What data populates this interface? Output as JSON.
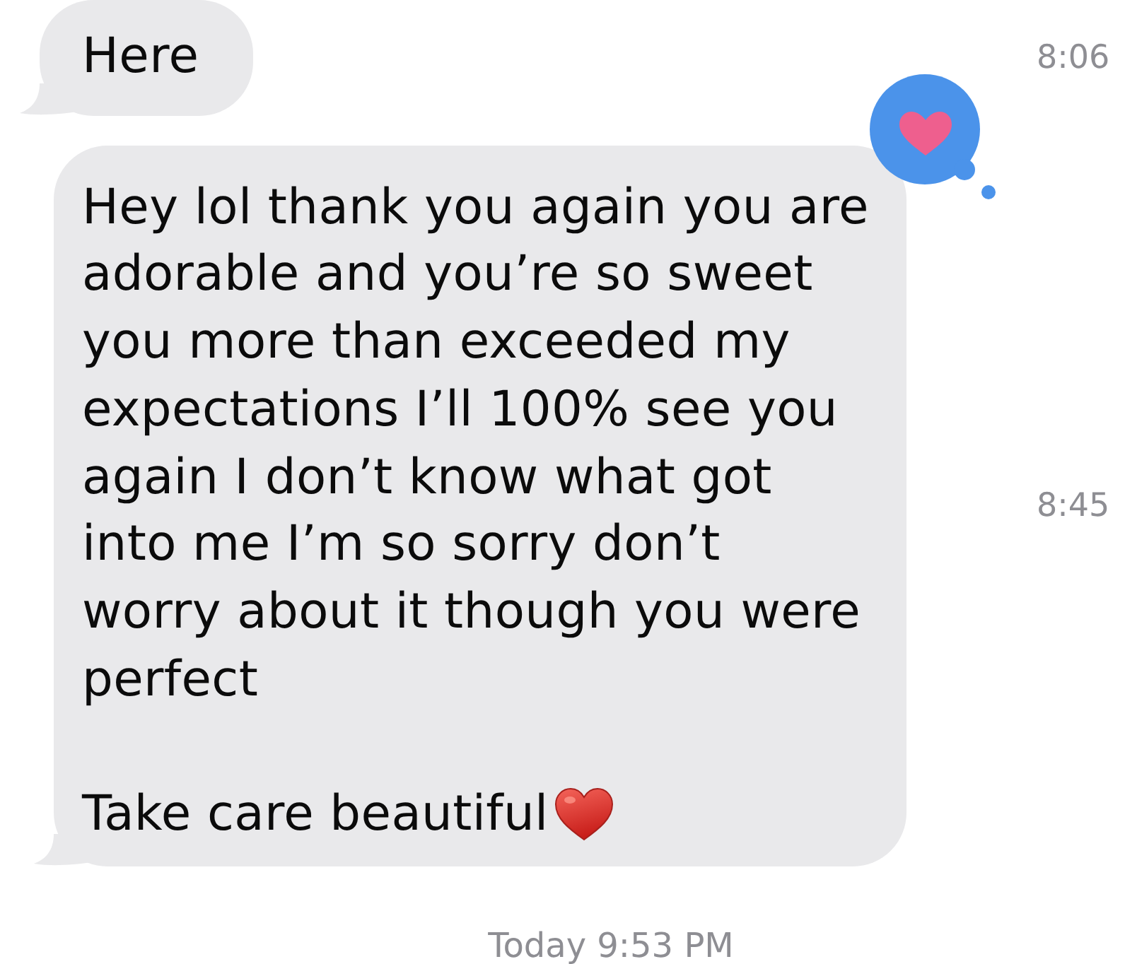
{
  "conversation": {
    "messages": [
      {
        "paragraphs": [
          {
            "text": "Here",
            "trailing_heart": false
          }
        ],
        "tapback": false,
        "timestamp": "8:06"
      },
      {
        "paragraphs": [
          {
            "text": "Hey lol thank you again you are adorable and you’re so sweet you more than exceeded my expectations I’ll 100% see you again I don’t know what got into me I’m so sorry don’t worry about it though you were perfect",
            "trailing_heart": false
          },
          {
            "text": "Take care beautiful",
            "trailing_heart": true
          }
        ],
        "tapback": true,
        "timestamp": "8:45"
      }
    ]
  },
  "footer": {
    "date": "Today 9:53 PM"
  }
}
